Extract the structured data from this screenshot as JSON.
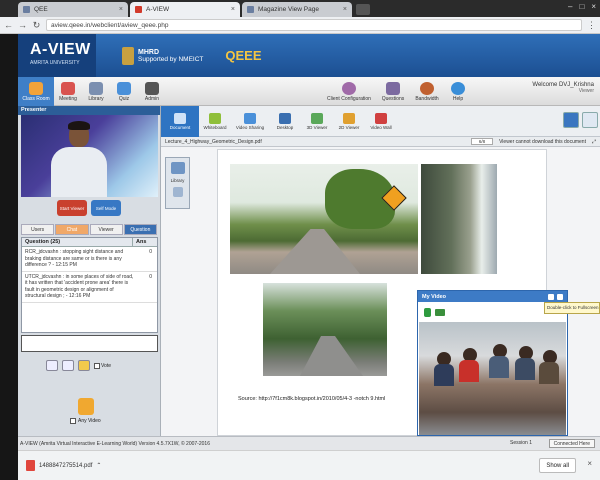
{
  "browser": {
    "tabs": [
      {
        "label": "QEE",
        "close": "×"
      },
      {
        "label": "A-VIEW",
        "close": "×"
      },
      {
        "label": "Magazine View Page",
        "close": "×"
      }
    ],
    "url": "aview.qeee.in/webclient/aview_qeee.php",
    "window_controls": [
      "–",
      "□",
      "×"
    ]
  },
  "banner": {
    "logo": "A-VIEW",
    "logo_sub": "AMRITA UNIVERSITY",
    "mhrd_line1": "MHRD",
    "mhrd_line2": "Supported by NMEICT",
    "program": "QEEE"
  },
  "toolbar": {
    "items": [
      {
        "label": "Class Room",
        "color": "#f2a33a"
      },
      {
        "label": "Meeting",
        "color": "#d9534f"
      },
      {
        "label": "Library",
        "color": "#7b8fb0"
      },
      {
        "label": "Quiz",
        "color": "#4a90d9"
      },
      {
        "label": "Admin",
        "color": "#555555"
      }
    ],
    "right_items": [
      {
        "label": "Client Configuration",
        "color": "#a06aa8"
      },
      {
        "label": "Questions",
        "color": "#7c6aa0"
      },
      {
        "label": "Bandwidth",
        "color": "#c06030"
      },
      {
        "label": "Help",
        "color": "#3a8ed8"
      }
    ],
    "welcome": "Welcome DVJ_Krishna",
    "welcome_sub": "Viewer"
  },
  "left_panel": {
    "presenter_label": "Presenter",
    "btn_left": "Start Viewer",
    "btn_right": "Self Mode",
    "tabs": [
      "Users",
      "Chat",
      "Viewer",
      "Question"
    ],
    "question_header": "Question (25)",
    "question_header2": "Ans",
    "questions": [
      {
        "text": "RCR_jdcvashn : stopping sight distance and braking distance are same or is there is any difference ? - 12:15 PM",
        "num": "0"
      },
      {
        "text": "UTCR_jdcvashn : in some places of side of road, it has written that 'accident prone area' there is fault in geometric design or alignment of structural design ; - 12:16 PM",
        "num": "0"
      }
    ],
    "vote": "Vote",
    "any_video": "Any Video"
  },
  "content_toolbar": {
    "items": [
      {
        "label": "Document",
        "color": "#2e74c2"
      },
      {
        "label": "Whiteboard",
        "color": "#8fbf3a"
      },
      {
        "label": "Video Sharing",
        "color": "#4a90d9"
      },
      {
        "label": "Desktop",
        "color": "#3a6fb0"
      },
      {
        "label": "3D Viewer",
        "color": "#5aa85a"
      },
      {
        "label": "2D Viewer",
        "color": "#e0a030"
      },
      {
        "label": "Video Wall",
        "color": "#d04040"
      }
    ]
  },
  "document": {
    "filename": "Lecture_4_Highway_Geometric_Design.pdf",
    "page": "6/8",
    "notice": "Viewer cannot download this document",
    "library_label": "Library",
    "caption": "Source: http://7f1cm8k.blogspot.in/2010/05/4-3 -notch 9.html"
  },
  "my_video": {
    "title": "My Video",
    "tooltip": "Double-click to Fullscreen"
  },
  "status": {
    "text": "A-VIEW (Amrita Virtual Interactive E-Learning World) Version 4.5.7X1W, © 2007-2016",
    "session": "Session 1",
    "connection": "Connected Here"
  },
  "download_bar": {
    "file": "1488847275514.pdf",
    "show_all": "Show all",
    "close": "×"
  }
}
